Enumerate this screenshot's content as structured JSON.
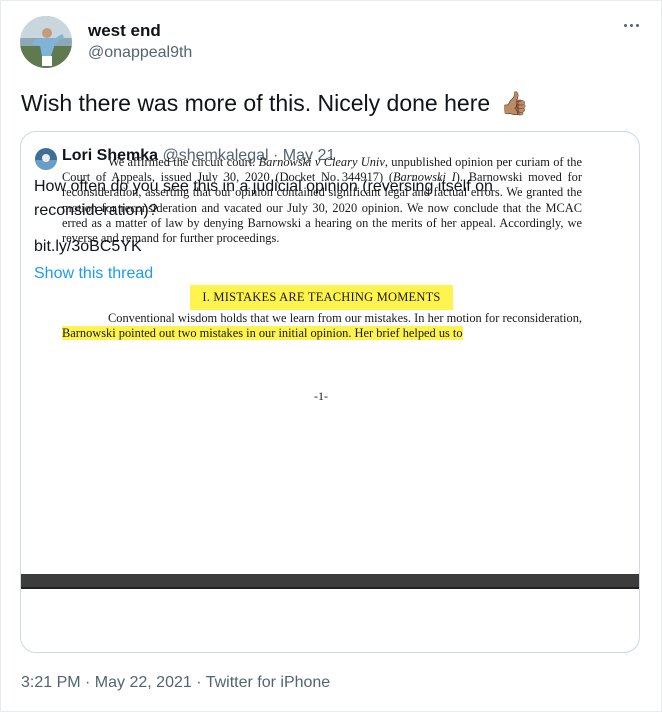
{
  "tweet": {
    "author_name": "west end",
    "author_handle": "@onappeal9th",
    "text": "Wish there was more of this. Nicely done here",
    "emoji": "👍🏽",
    "timestamp": "3:21 PM · May 22, 2021",
    "source": "Twitter for iPhone"
  },
  "quoted_tweet": {
    "author_name": "Lori Shemka",
    "author_handle": "@shemkalegal",
    "date": "· May 21",
    "text": "How often do you see this in a judicial opinion (reversing itself on reconsideration)?",
    "link": "bit.ly/3oBC5YK",
    "show_thread": "Show this thread"
  },
  "document": {
    "paragraph1_a": "We affirmed the circuit court. ",
    "paragraph1_case": "Barnowski v Cleary Univ",
    "paragraph1_b": ", unpublished opinion per curiam of the Court of Appeals, issued July 30, 2020 (Docket No 344917) (",
    "paragraph1_short": "Barnowski I",
    "paragraph1_c": "). Barnowski moved for reconsideration, asserting that our opinion contained significant legal and factual errors. We granted the motion for reconsideration and vacated our July 30, 2020 opinion. We now conclude that the MCAC erred as a matter of law by denying Barnowski a hearing on the merits of her appeal. Accordingly, we reverse and remand for further proceedings.",
    "heading": "I.  MISTAKES ARE TEACHING MOMENTS",
    "paragraph2_a": "Conventional wisdom holds that we learn from our mistakes. In her motion for reconsideration, ",
    "paragraph2_highlight": "Barnowski pointed out two mistakes in our initial opinion. Her brief helped us to",
    "page_number": "-1-"
  },
  "colors": {
    "link_blue": "#1d9bf0",
    "secondary_text": "#536471",
    "highlight": "#fff34d"
  },
  "icons": {
    "more": "more-horizontal-icon",
    "thumbs_up": "thumbs-up-icon"
  }
}
